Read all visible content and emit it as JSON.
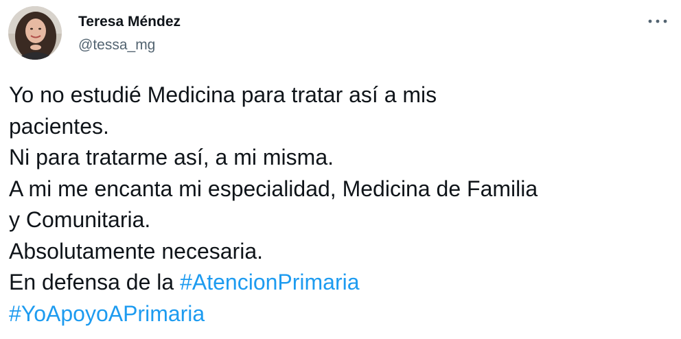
{
  "author": {
    "name": "Teresa Méndez",
    "handle": "@tessa_mg",
    "avatar_icon": "profile-photo"
  },
  "menu": {
    "icon": "more-horizontal-icon"
  },
  "tweet": {
    "lines": [
      "Yo no estudié Medicina para tratar así a mis",
      "pacientes.",
      "Ni para tratarme así, a mi misma.",
      "A mi me encanta mi especialidad, Medicina de Familia",
      "y Comunitaria.",
      "Absolutamente necesaria.",
      "En defensa de la "
    ],
    "hashtags": [
      "#AtencionPrimaria",
      "#YoApoyoAPrimaria"
    ]
  },
  "colors": {
    "text": "#0f1419",
    "secondary": "#536471",
    "link": "#1d9bf0"
  }
}
